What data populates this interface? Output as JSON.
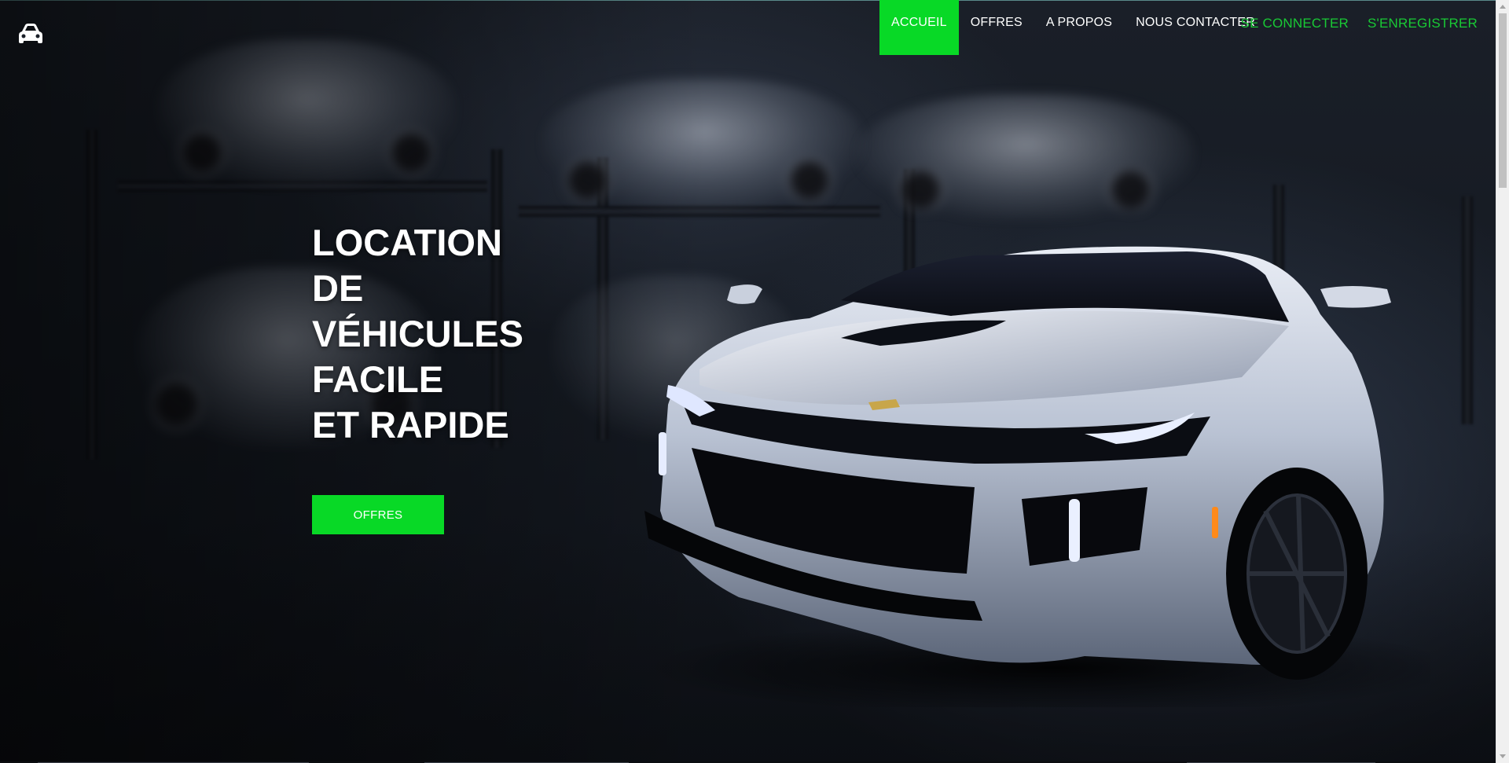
{
  "brand": {
    "logo_icon": "car-icon",
    "accent_color": "#08d926",
    "link_color": "#19c935"
  },
  "nav": {
    "items": [
      {
        "label": "ACCUEIL",
        "active": true
      },
      {
        "label": "OFFRES",
        "active": false
      },
      {
        "label": "A PROPOS",
        "active": false
      },
      {
        "label": "NOUS CONTACTER",
        "active": false
      }
    ]
  },
  "auth": {
    "login_label": "SE CONNECTER",
    "register_label": "S'ENREGISTRER"
  },
  "hero": {
    "title_lines": [
      "LOCATION",
      "DE",
      "VÉHICULES",
      "FACILE",
      "ET RAPIDE"
    ],
    "cta_label": "OFFRES"
  }
}
